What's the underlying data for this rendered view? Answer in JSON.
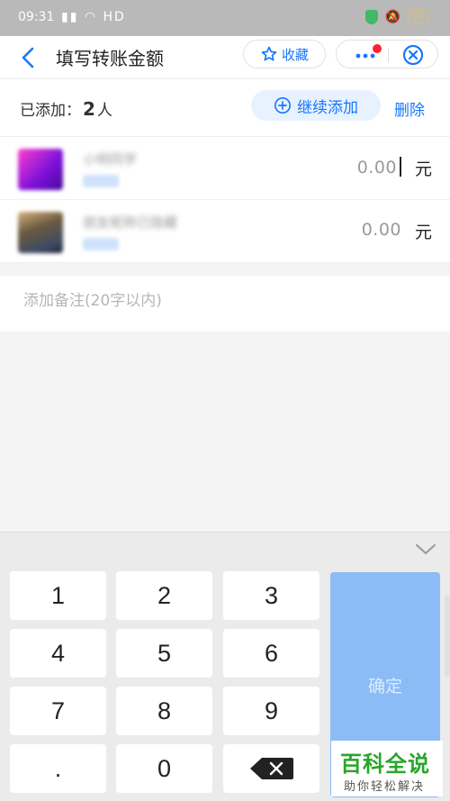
{
  "status_bar": {
    "time": "09:31",
    "network": "HD",
    "battery": "90"
  },
  "header": {
    "title": "填写转账金额",
    "favorite_label": "收藏"
  },
  "recipients_bar": {
    "label": "已添加：",
    "count": "2",
    "unit": "人",
    "continue_label": "继续添加",
    "delete_label": "删除"
  },
  "recipients": [
    {
      "name": "小明同学",
      "amount": "0.00",
      "currency": "元"
    },
    {
      "name": "朋友昵称已隐藏",
      "amount": "0.00",
      "currency": "元"
    }
  ],
  "remark": {
    "placeholder": "添加备注(20字以内)"
  },
  "keypad": {
    "keys": [
      "1",
      "2",
      "3",
      "4",
      "5",
      "6",
      "7",
      "8",
      "9",
      ".",
      "0"
    ],
    "confirm_label": "确定"
  },
  "watermark": {
    "title": "百科全说",
    "subtitle": "助你轻松解决"
  },
  "colors": {
    "accent": "#1677ff",
    "confirm_disabled": "#8bbcf5",
    "badge_dot": "#ff2233"
  },
  "icons": [
    "back-arrow-icon",
    "star-icon",
    "more-icon",
    "close-circle-icon",
    "plus-circle-icon",
    "chevron-down-icon",
    "backspace-icon"
  ]
}
